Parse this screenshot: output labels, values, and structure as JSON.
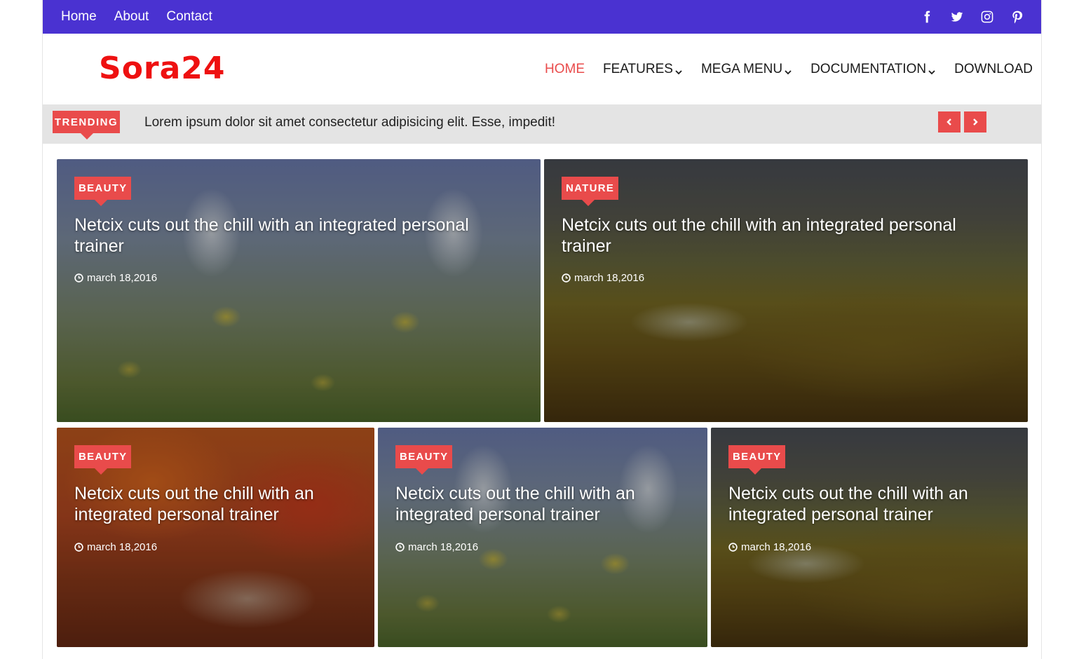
{
  "topbar": {
    "links": [
      "Home",
      "About",
      "Contact"
    ],
    "social_icons": [
      "facebook-icon",
      "twitter-icon",
      "instagram-icon",
      "pinterest-icon"
    ],
    "bg_color": "#4a32d1"
  },
  "header": {
    "logo": "Sora24",
    "logo_color": "#ee1111",
    "nav": [
      {
        "label": "HOME",
        "active": true
      },
      {
        "label": "FEATURES",
        "dropdown": true
      },
      {
        "label": "MEGA MENU",
        "dropdown": true
      },
      {
        "label": "DOCUMENTATION",
        "dropdown": true
      },
      {
        "label": "DOWNLOAD"
      }
    ],
    "accent_color": "#e94b4b"
  },
  "trending": {
    "label": "TRENDING",
    "text": "Lorem ipsum dolor sit amet consectetur adipisicing elit. Esse, impedit!",
    "prev_icon": "chevron-left-icon",
    "next_icon": "chevron-right-icon"
  },
  "posts": [
    {
      "category": "BEAUTY",
      "title": "Netcix cuts out the chill with an integrated personal trainer",
      "date": "march 18,2016"
    },
    {
      "category": "NATURE",
      "title": "Netcix cuts out the chill with an integrated personal trainer",
      "date": "march 18,2016"
    },
    {
      "category": "BEAUTY",
      "title": "Netcix cuts out the chill with an integrated personal trainer",
      "date": "march 18,2016"
    },
    {
      "category": "BEAUTY",
      "title": "Netcix cuts out the chill with an integrated personal trainer",
      "date": "march 18,2016"
    },
    {
      "category": "BEAUTY",
      "title": "Netcix cuts out the chill with an integrated personal trainer",
      "date": "march 18,2016"
    }
  ]
}
